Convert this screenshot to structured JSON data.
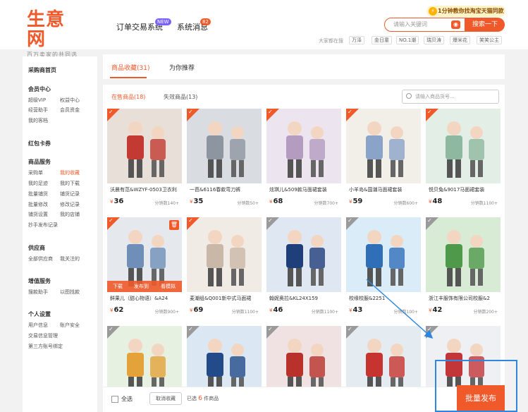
{
  "header": {
    "logo": "生意网",
    "slogan": "百万卖家的共同选择",
    "nav": [
      {
        "label": "订单交易系统",
        "badge": "NEW"
      },
      {
        "label": "系统消息",
        "badge": "82"
      }
    ],
    "promo": "1分钟教你找淘宝天猫同款",
    "search_placeholder": "请输入关键词",
    "search_btn": "搜索一下",
    "hot_label": "大家都在搜",
    "hot_tags": [
      "万泽",
      "金日童",
      "NO.1潮",
      "瑞贝涛",
      "爆米花",
      "笑笑公主"
    ]
  },
  "sidebar": {
    "home": "采购商首页",
    "member": {
      "title": "会员中心",
      "links": [
        "超级VIP",
        "权益中心",
        "经营助手",
        "会员资金",
        "我的客档"
      ]
    },
    "coupon": "红包卡券",
    "goods": {
      "title": "商品服务",
      "links": [
        "采购单",
        "我的收藏",
        "我的足迹",
        "我的下载",
        "批量铺货",
        "铺货记录",
        "批量修改",
        "修改记录",
        "铺货设置",
        "我的店铺",
        "抄手发布记录"
      ]
    },
    "supplier": {
      "title": "供应商",
      "links": [
        "全部供应商",
        "我关注的"
      ]
    },
    "value": {
      "title": "增值服务",
      "links": [
        "搜款助手",
        "以图找款"
      ]
    },
    "personal": {
      "title": "个人设置",
      "links": [
        "用户信息",
        "账户安全",
        "交易信息管理",
        "第三方账号绑定"
      ]
    }
  },
  "tabs": {
    "collected": "商品收藏(31)",
    "recommend": "为你推荐"
  },
  "subtabs": {
    "on_sale": "在售商品(18)",
    "invalid": "失效商品(13)"
  },
  "goods_search_placeholder": "请输入商品货号...",
  "hover_actions": [
    "下载",
    "发布到",
    "看模拟"
  ],
  "cards": [
    {
      "title": "沃晨有范&WZYF-0503卫衣利",
      "price": "36",
      "sold": "分销数140+",
      "checked": true
    },
    {
      "title": "一芭&6116春款弯刀裤",
      "price": "35",
      "sold": "分销数50+",
      "checked": true
    },
    {
      "title": "炫琪儿&509款马面裙套装",
      "price": "68",
      "sold": "分销数700+",
      "checked": true
    },
    {
      "title": "小羊岛&国潮马面裙套装",
      "price": "59",
      "sold": "分销数600+",
      "checked": true
    },
    {
      "title": "悦贝兔&9017马面裙套装",
      "price": "48",
      "sold": "分销数1100+",
      "checked": true
    },
    {
      "title": "鲜果儿（甜心物语）&A24",
      "price": "62",
      "sold": "分销数900+",
      "checked": true
    },
    {
      "title": "麦潮组&Q001新中式马面裙",
      "price": "69",
      "sold": "分销数1100+",
      "checked": true
    },
    {
      "title": "翰妮奥拉&KL24X159",
      "price": "46",
      "sold": "分销数1100+",
      "checked": false
    },
    {
      "title": "校缘校服&2251",
      "price": "43",
      "sold": "分销数100+",
      "checked": false
    },
    {
      "title": "浙江丰服饰有限公司校服&2",
      "price": "42",
      "sold": "分销数200+",
      "checked": false
    },
    {
      "title": "",
      "price": "",
      "sold": "",
      "checked": false
    },
    {
      "title": "",
      "price": "",
      "sold": "",
      "checked": false
    },
    {
      "title": "",
      "price": "",
      "sold": "",
      "checked": false
    },
    {
      "title": "",
      "price": "",
      "sold": "",
      "checked": false
    },
    {
      "title": "",
      "price": "",
      "sold": "",
      "checked": false
    }
  ],
  "bottom": {
    "select_all": "全选",
    "cancel": "取消收藏",
    "selected_prefix": "已选",
    "selected_count": "6",
    "selected_suffix": "件商品",
    "batch_publish": "批量发布"
  },
  "colors": {
    "accent": "#f0592a",
    "annotation": "#2e86de"
  }
}
